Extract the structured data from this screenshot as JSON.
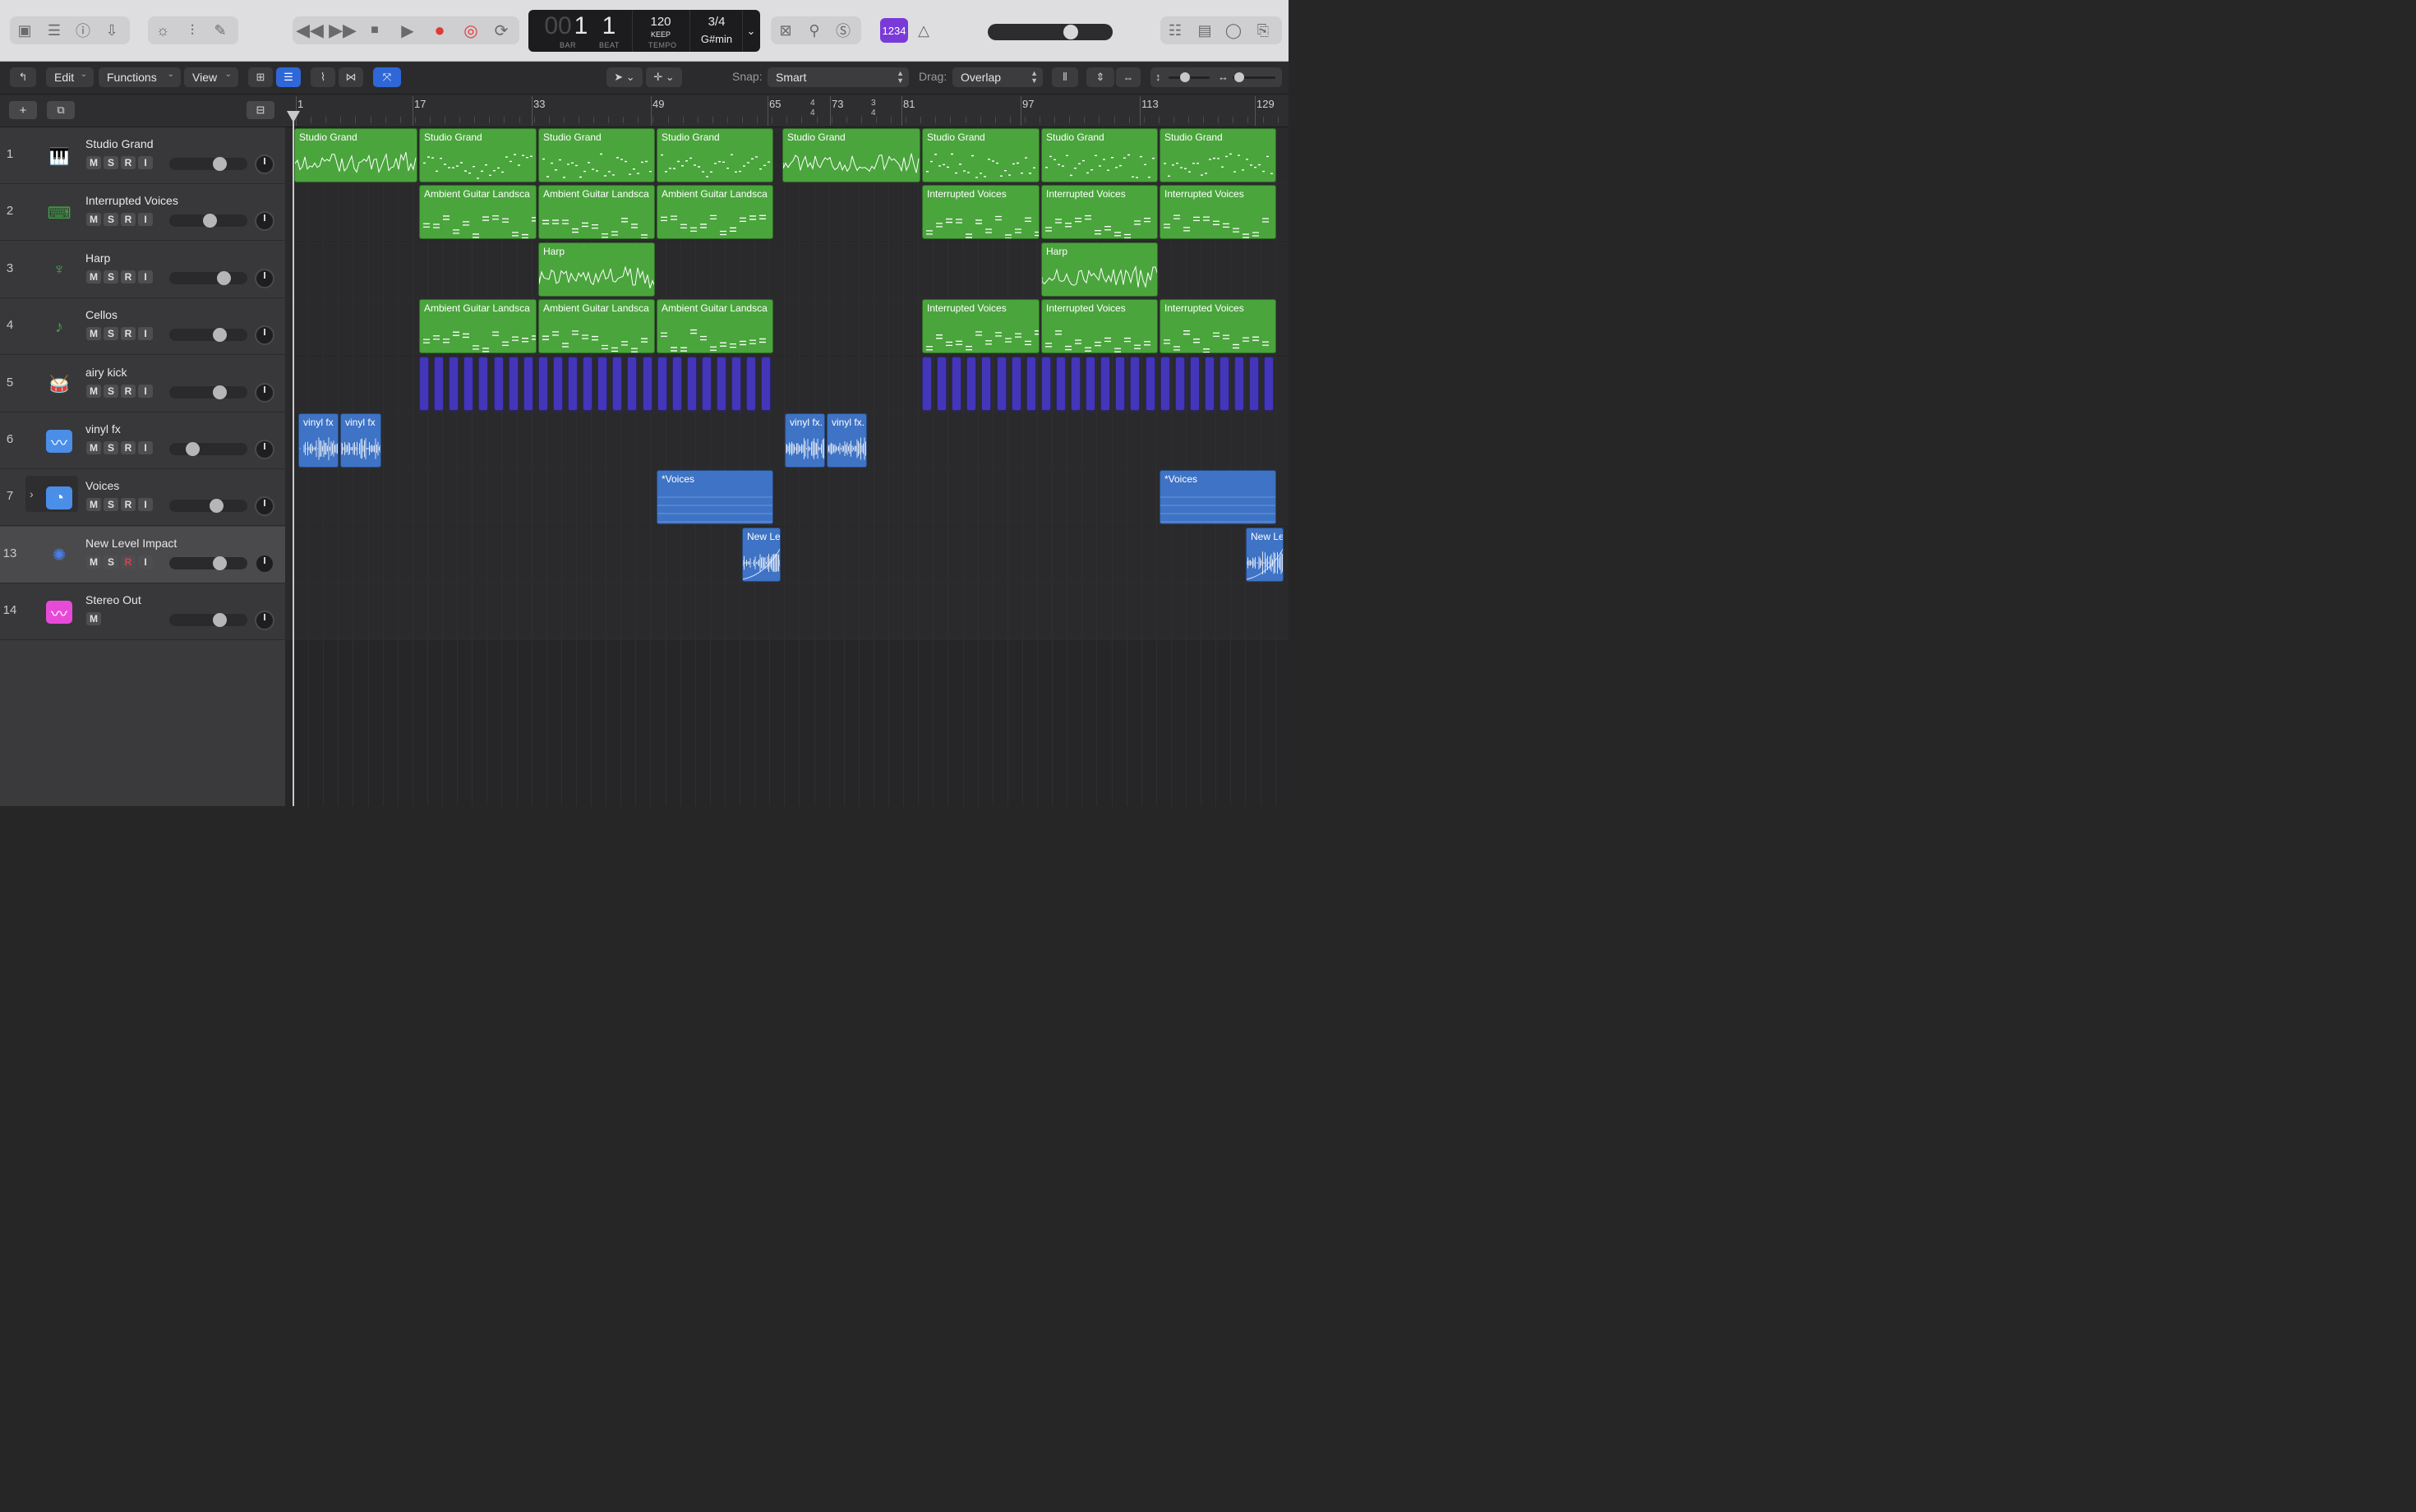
{
  "transport": {
    "bar_dim": "00",
    "bar": "1",
    "beat": "1",
    "bar_label": "BAR",
    "beat_label": "BEAT",
    "tempo": "120",
    "tempo_mode": "KEEP",
    "tempo_label": "TEMPO",
    "signature": "3/4",
    "key": "G#min"
  },
  "count_in_badge": "1234",
  "toolbar": {
    "edit": "Edit",
    "functions": "Functions",
    "view": "View",
    "snap_label": "Snap:",
    "snap_value": "Smart",
    "drag_label": "Drag:",
    "drag_value": "Overlap"
  },
  "ruler": {
    "marks": [
      "1",
      "17",
      "33",
      "49",
      "65",
      "73",
      "81",
      "97",
      "113",
      "129"
    ],
    "time_sig_1": {
      "top": "4",
      "bottom": "4"
    },
    "time_sig_2": {
      "top": "3",
      "bottom": "4"
    }
  },
  "tracks": [
    {
      "num": "1",
      "name": "Studio Grand",
      "icon": "piano-icon",
      "color": "#3fa545",
      "buttons": [
        "M",
        "S",
        "R",
        "I"
      ]
    },
    {
      "num": "2",
      "name": "Interrupted Voices",
      "icon": "synth-keyboard-icon",
      "color": "#3fa545",
      "buttons": [
        "M",
        "S",
        "R",
        "I"
      ]
    },
    {
      "num": "3",
      "name": "Harp",
      "icon": "harp-icon",
      "color": "#3fa545",
      "buttons": [
        "M",
        "S",
        "R",
        "I"
      ]
    },
    {
      "num": "4",
      "name": "Cellos",
      "icon": "cello-icon",
      "color": "#3fa545",
      "buttons": [
        "M",
        "S",
        "R",
        "I"
      ]
    },
    {
      "num": "5",
      "name": "airy kick",
      "icon": "drum-kit-icon",
      "color": "#8878e8",
      "buttons": [
        "M",
        "S",
        "R",
        "I"
      ]
    },
    {
      "num": "6",
      "name": "vinyl fx",
      "icon": "waveform-icon",
      "color": "#4a8ee8",
      "buttons": [
        "M",
        "S",
        "R",
        "I"
      ]
    },
    {
      "num": "7",
      "name": "Voices",
      "icon": "clock-icon",
      "color": "#4a8ee8",
      "buttons": [
        "M",
        "S",
        "R",
        "I"
      ]
    },
    {
      "num": "13",
      "name": "New Level Impact",
      "icon": "burst-icon",
      "color": "#4a7ee8",
      "buttons": [
        "M",
        "S",
        "R",
        "I"
      ]
    },
    {
      "num": "14",
      "name": "Stereo Out",
      "icon": "output-waveform-icon",
      "color": "#e84ad8",
      "buttons": [
        "M"
      ]
    }
  ],
  "regions": {
    "studio_grand": "Studio Grand",
    "ambient_guitar": "Ambient Guitar Landsca",
    "interrupted_voices": "Interrupted Voices",
    "harp": "Harp",
    "vinyl_fx": "vinyl fx",
    "vinyl_fx_dot": "vinyl fx.",
    "voices": "*Voices",
    "new_level": "New Le"
  },
  "colors": {
    "midi_region": "#4aa53c",
    "audio_region": "#3e73c5",
    "drum_region": "#4436b8",
    "accent": "#2f67d8"
  }
}
